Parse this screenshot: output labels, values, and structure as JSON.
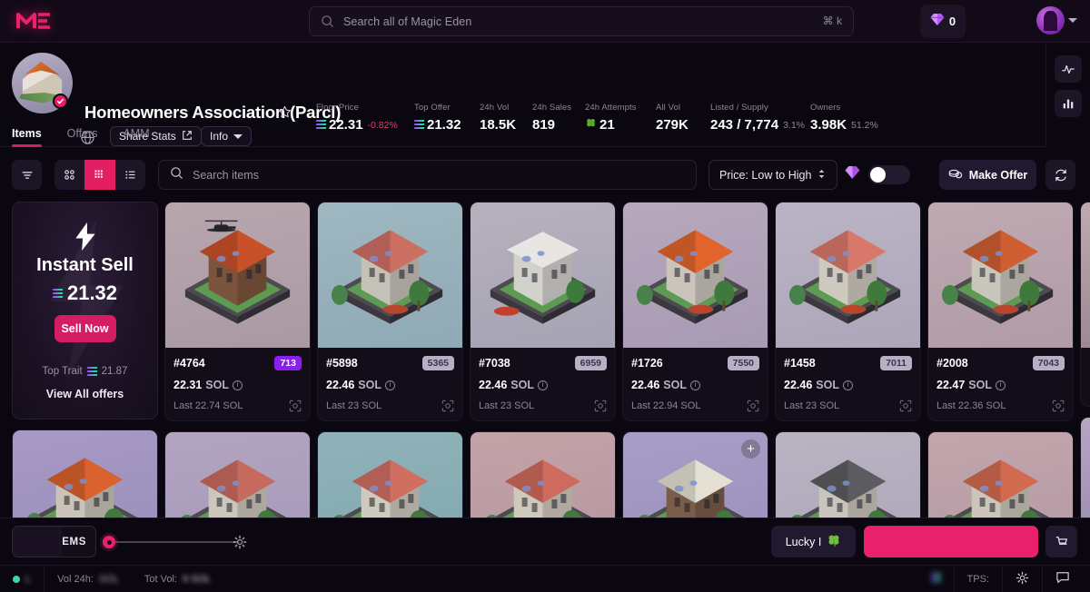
{
  "topnav": {
    "logo_icon": "magic-eden-logo",
    "search": {
      "placeholder": "Search all of Magic Eden",
      "icon": "search-icon",
      "shortcut": "⌘ k"
    },
    "gems": {
      "icon": "diamond-icon",
      "count": "0"
    },
    "avatar": {
      "icon": "user-avatar",
      "chevron": "chevron-down-icon"
    }
  },
  "collection": {
    "name": "Homeowners Association (Parcl)",
    "verified_icon": "verified-check-icon",
    "favorite_icon": "star-outline-icon",
    "website_icon": "globe-icon",
    "share_stats_label": "Share Stats",
    "share_icon": "share-external-icon",
    "info_label": "Info",
    "info_chevron": "chevron-down-icon",
    "stats": [
      {
        "label": "Floor Price",
        "value": "22.31",
        "sub": "-0.82%",
        "sub_kind": "down",
        "sol": true
      },
      {
        "label": "Top Offer",
        "value": "21.32",
        "sub": "",
        "sub_kind": "",
        "sol": true
      },
      {
        "label": "24h Vol",
        "value": "18.5K",
        "sub": "",
        "sub_kind": "",
        "sol": false
      },
      {
        "label": "24h Sales",
        "value": "819",
        "sub": "",
        "sub_kind": "",
        "sol": false
      },
      {
        "label": "24h Attempts",
        "value": "21",
        "sub": "",
        "sub_kind": "",
        "sol": false,
        "clover": true
      },
      {
        "label": "All Vol",
        "value": "279K",
        "sub": "",
        "sub_kind": "",
        "sol": false
      },
      {
        "label": "Listed / Supply",
        "value": "243 / 7,774",
        "sub": "3.1%",
        "sub_kind": "dim",
        "sol": false
      },
      {
        "label": "Owners",
        "value": "3.98K",
        "sub": "51.2%",
        "sub_kind": "dim",
        "sol": false
      }
    ]
  },
  "tabs": [
    {
      "label": "Items",
      "active": true
    },
    {
      "label": "Offers",
      "active": false
    },
    {
      "label": "AMM",
      "active": false
    }
  ],
  "toolbar": {
    "filter_icon": "filter-icon",
    "views": [
      {
        "icon": "grid-large-icon",
        "selected": false
      },
      {
        "icon": "grid-small-icon",
        "selected": true
      },
      {
        "icon": "list-view-icon",
        "selected": false
      }
    ],
    "search_placeholder": "Search items",
    "search_icon": "search-icon",
    "sort_value": "Price: Low to High",
    "sort_icon": "sort-updown-icon",
    "gem_toggle_icon": "diamond-icon",
    "gem_toggle_on": false,
    "make_offer_label": "Make Offer",
    "make_offer_icon": "coins-icon",
    "refresh_icon": "refresh-icon"
  },
  "right_rail": [
    {
      "icon": "activity-pulse-icon"
    },
    {
      "icon": "bar-chart-icon"
    }
  ],
  "instant_sell": {
    "bolt_icon": "lightning-bolt-icon",
    "title": "Instant Sell",
    "price": "21.32",
    "sell_label": "Sell Now",
    "top_trait_label": "Top Trait",
    "top_trait_value": "21.87",
    "view_all_label": "View All offers"
  },
  "grid": {
    "info_icon": "info-circle-icon",
    "scan_icon": "scan-frame-icon",
    "plus_icon": "plus-icon",
    "currency": "SOL",
    "row1": [
      {
        "id": "#4764",
        "rank": "713",
        "rank_color": "#8b1ef0",
        "rank_text": "#ffffff",
        "price": "22.31",
        "last": "Last 22.74 SOL",
        "bg": "#b9a7ae",
        "roof": "#c8512a",
        "body": "#8d6046",
        "style": "helicopter"
      },
      {
        "id": "#5898",
        "rank": "5365",
        "rank_color": "#b4b0c6",
        "rank_text": "#3c3547",
        "price": "22.46",
        "last": "Last 23 SOL",
        "bg": "#9fb7c0",
        "roof": "#cc6f63",
        "body": "#e2dcd0",
        "style": "villa"
      },
      {
        "id": "#7038",
        "rank": "6959",
        "rank_color": "#b4b0c6",
        "rank_text": "#3c3547",
        "price": "22.46",
        "last": "Last 23 SOL",
        "bg": "#b6b1bd",
        "roof": "#e8e6e2",
        "body": "#f0eee9",
        "style": "modern"
      },
      {
        "id": "#1726",
        "rank": "7550",
        "rank_color": "#b4b0c6",
        "rank_text": "#3c3547",
        "price": "22.46",
        "last": "Last 22.94 SOL",
        "bg": "#b7a8bd",
        "roof": "#e0642c",
        "body": "#e6e0d4",
        "style": "villa"
      },
      {
        "id": "#1458",
        "rank": "7011",
        "rank_color": "#b4b0c6",
        "rank_text": "#3c3547",
        "price": "22.46",
        "last": "Last 23 SOL",
        "bg": "#bcb4c4",
        "roof": "#d9786a",
        "body": "#ebe6da",
        "style": "villa"
      },
      {
        "id": "#2008",
        "rank": "7043",
        "rank_color": "#b4b0c6",
        "rank_text": "#3c3547",
        "price": "22.47",
        "last": "Last 22.36 SOL",
        "bg": "#c0a9b1",
        "roof": "#cf5f33",
        "body": "#e8e2d6",
        "style": "villa"
      }
    ],
    "row2": [
      {
        "bg": "#a79ac4",
        "roof": "#d9622e",
        "body": "#e5dfd2",
        "plus": false
      },
      {
        "bg": "#b3a5c1",
        "roof": "#c76a5e",
        "body": "#e9e3d6",
        "plus": false
      },
      {
        "bg": "#8fb3b8",
        "roof": "#cf6f62",
        "body": "#ece6d9",
        "plus": false
      },
      {
        "bg": "#c4a3a8",
        "roof": "#cf6b5c",
        "body": "#ece5d7",
        "plus": false
      },
      {
        "bg": "#a89dc6",
        "roof": "#e4e0d4",
        "body": "#8b6a52",
        "plus": true
      },
      {
        "bg": "#bbb3c2",
        "roof": "#5c5c60",
        "body": "#e6e1d6",
        "plus": false
      },
      {
        "bg": "#c2a6ad",
        "roof": "#d26a4f",
        "body": "#e9e2d4",
        "plus": false
      }
    ]
  },
  "cartbar": {
    "items_label": "ITEMS",
    "items_value": "",
    "slider_gear_icon": "gear-icon",
    "lucky_label": "Lucky I",
    "lucky_icon": "clover-icon",
    "buy_label": "",
    "cart_icon": "shopping-cart-icon"
  },
  "statusbar": {
    "status_dot": "online-dot",
    "status_text": "L",
    "vol_24h_label": "Vol 24h:",
    "vol_24h_value": "SOL",
    "tot_vol_label": "Tot Vol:",
    "tot_vol_value": "9 SOL",
    "tps_label": "TPS:",
    "sol_icon": "solana-icon",
    "gear_icon": "gear-icon",
    "chat_icon": "chat-bubble-icon"
  }
}
